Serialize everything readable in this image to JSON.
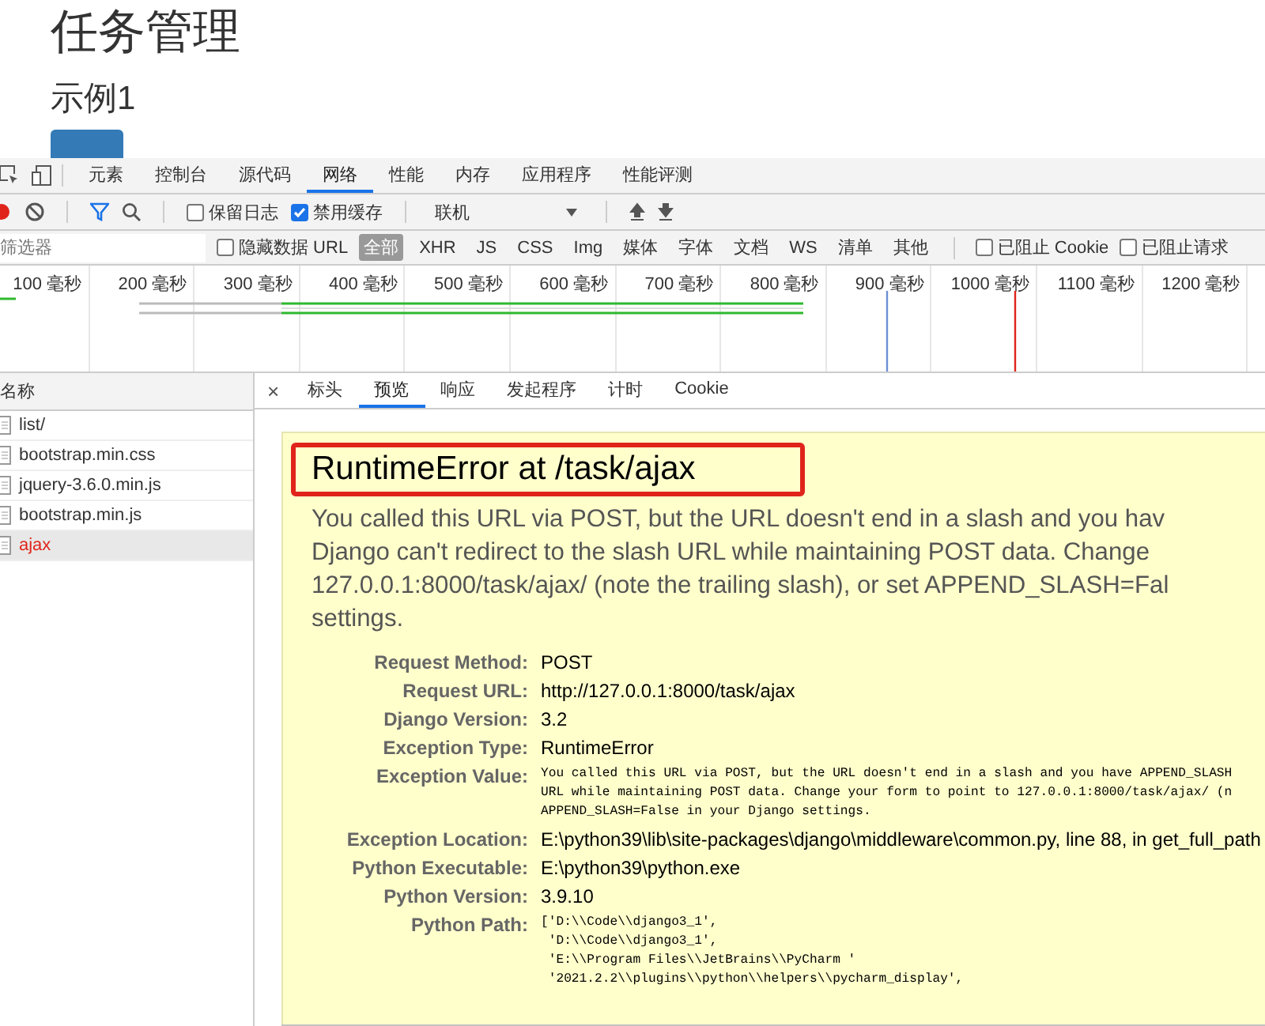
{
  "page": {
    "title": "任务管理",
    "subtitle": "示例1"
  },
  "devtools": {
    "tabs": [
      {
        "label": "元素",
        "selected": false
      },
      {
        "label": "控制台",
        "selected": false
      },
      {
        "label": "源代码",
        "selected": false
      },
      {
        "label": "网络",
        "selected": true
      },
      {
        "label": "性能",
        "selected": false
      },
      {
        "label": "内存",
        "selected": false
      },
      {
        "label": "应用程序",
        "selected": false
      },
      {
        "label": "性能评测",
        "selected": false
      }
    ],
    "toolbar": {
      "preserve_log": {
        "label": "保留日志",
        "checked": false
      },
      "disable_cache": {
        "label": "禁用缓存",
        "checked": true
      },
      "throttling": "联机"
    },
    "filter": {
      "placeholder": "筛选器",
      "hide_data_urls": {
        "label": "隐藏数据 URL",
        "checked": false
      },
      "types": [
        {
          "label": "全部",
          "selected": true
        },
        {
          "label": "XHR",
          "selected": false
        },
        {
          "label": "JS",
          "selected": false
        },
        {
          "label": "CSS",
          "selected": false
        },
        {
          "label": "Img",
          "selected": false
        },
        {
          "label": "媒体",
          "selected": false
        },
        {
          "label": "字体",
          "selected": false
        },
        {
          "label": "文档",
          "selected": false
        },
        {
          "label": "WS",
          "selected": false
        },
        {
          "label": "清单",
          "selected": false
        },
        {
          "label": "其他",
          "selected": false
        }
      ],
      "blocked_cookies": {
        "label": "已阻止 Cookie",
        "checked": false
      },
      "blocked_requests": {
        "label": "已阻止请求",
        "checked": false
      }
    },
    "timeline_ticks": [
      "100 毫秒",
      "200 毫秒",
      "300 毫秒",
      "400 毫秒",
      "500 毫秒",
      "600 毫秒",
      "700 毫秒",
      "800 毫秒",
      "900 毫秒",
      "1000 毫秒",
      "1100 毫秒",
      "1200 毫秒"
    ],
    "requests": {
      "header": "名称",
      "rows": [
        {
          "name": "list/",
          "selected": false,
          "failed": false
        },
        {
          "name": "bootstrap.min.css",
          "selected": false,
          "failed": false
        },
        {
          "name": "jquery-3.6.0.min.js",
          "selected": false,
          "failed": false
        },
        {
          "name": "bootstrap.min.js",
          "selected": false,
          "failed": false
        },
        {
          "name": "ajax",
          "selected": true,
          "failed": true
        }
      ]
    },
    "detail_tabs": [
      {
        "label": "标头",
        "selected": false
      },
      {
        "label": "预览",
        "selected": true
      },
      {
        "label": "响应",
        "selected": false
      },
      {
        "label": "发起程序",
        "selected": false
      },
      {
        "label": "计时",
        "selected": false
      },
      {
        "label": "Cookie",
        "selected": false
      }
    ],
    "close_symbol": "×"
  },
  "error": {
    "title": "RuntimeError at /task/ajax",
    "description": [
      "You called this URL via POST, but the URL doesn't end in a slash and you hav",
      "Django can't redirect to the slash URL while maintaining POST data. Change",
      "127.0.0.1:8000/task/ajax/ (note the trailing slash), or set APPEND_SLASH=Fal",
      "settings."
    ],
    "meta": [
      {
        "kind": "text",
        "label": "Request Method:",
        "lines": [
          "POST"
        ]
      },
      {
        "kind": "text",
        "label": "Request URL:",
        "lines": [
          "http://127.0.0.1:8000/task/ajax"
        ]
      },
      {
        "kind": "text",
        "label": "Django Version:",
        "lines": [
          "3.2"
        ]
      },
      {
        "kind": "text",
        "label": "Exception Type:",
        "lines": [
          "RuntimeError"
        ]
      },
      {
        "kind": "code",
        "label": "Exception Value:",
        "lines": [
          "You called this URL via POST, but the URL doesn't end in a slash and you have APPEND_SLASH",
          "URL while maintaining POST data. Change your form to point to 127.0.0.1:8000/task/ajax/ (n",
          "APPEND_SLASH=False in your Django settings."
        ]
      },
      {
        "kind": "text",
        "label": "Exception Location:",
        "lines": [
          "E:\\python39\\lib\\site-packages\\django\\middleware\\common.py, line 88, in get_full_path"
        ]
      },
      {
        "kind": "text",
        "label": "Python Executable:",
        "lines": [
          "E:\\python39\\python.exe"
        ]
      },
      {
        "kind": "text",
        "label": "Python Version:",
        "lines": [
          "3.9.10"
        ]
      },
      {
        "kind": "code",
        "label": "Python Path:",
        "lines": [
          "['D:\\\\Code\\\\django3_1',",
          " 'D:\\\\Code\\\\django3_1',",
          " 'E:\\\\Program Files\\\\JetBrains\\\\PyCharm '",
          " '2021.2.2\\\\plugins\\\\python\\\\helpers\\\\pycharm_display',"
        ]
      }
    ]
  }
}
